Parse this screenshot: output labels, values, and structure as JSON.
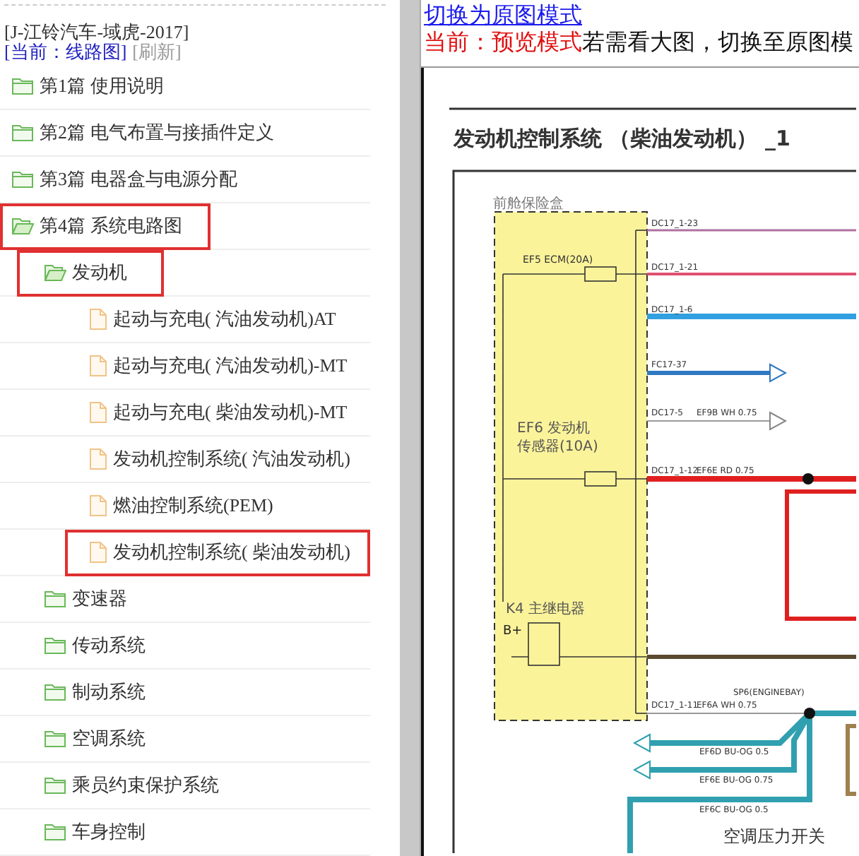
{
  "sidebar": {
    "book_title": "[J-江铃汽车-域虎-2017]",
    "current": "[当前：线路图]",
    "refresh": "[刷新]",
    "tree": [
      {
        "kind": "folder",
        "label": "第1篇 使用说明",
        "expanded": false,
        "marked": false
      },
      {
        "kind": "folder",
        "label": "第2篇 电气布置与接插件定义",
        "expanded": false,
        "marked": false
      },
      {
        "kind": "folder",
        "label": "第3篇 电器盒与电源分配",
        "expanded": false,
        "marked": false
      },
      {
        "kind": "folder",
        "label": "第4篇 系统电路图",
        "expanded": true,
        "marked": true,
        "children": [
          {
            "kind": "folder",
            "label": "发动机",
            "expanded": true,
            "marked": true,
            "children": [
              {
                "kind": "file",
                "label": "起动与充电( 汽油发动机)AT",
                "marked": false
              },
              {
                "kind": "file",
                "label": "起动与充电( 汽油发动机)-MT",
                "marked": false
              },
              {
                "kind": "file",
                "label": "起动与充电( 柴油发动机)-MT",
                "marked": false
              },
              {
                "kind": "file",
                "label": "发动机控制系统( 汽油发动机)",
                "marked": false
              },
              {
                "kind": "file",
                "label": "燃油控制系统(PEM)",
                "marked": false
              },
              {
                "kind": "file",
                "label": "发动机控制系统( 柴油发动机)",
                "marked": true
              }
            ]
          },
          {
            "kind": "folder",
            "label": "变速器",
            "expanded": false,
            "marked": false
          },
          {
            "kind": "folder",
            "label": "传动系统",
            "expanded": false,
            "marked": false
          },
          {
            "kind": "folder",
            "label": "制动系统",
            "expanded": false,
            "marked": false
          },
          {
            "kind": "folder",
            "label": "空调系统",
            "expanded": false,
            "marked": false
          },
          {
            "kind": "folder",
            "label": "乘员约束保护系统",
            "expanded": false,
            "marked": false
          },
          {
            "kind": "folder",
            "label": "车身控制",
            "expanded": false,
            "marked": false
          }
        ]
      }
    ]
  },
  "viewer": {
    "switch_link": "切换为原图模式",
    "mode_label": "当前：预览模式",
    "hint": "若需看大图，切换至原图模"
  },
  "diagram": {
    "title": "发动机控制系统 （柴油发动机） _1",
    "labels": [
      "前舱保险盒",
      "DC17_1-23",
      "EF5 ECM(20A)",
      "DC17_1-21",
      "DC17_1-6",
      "FC17-37",
      "DC17-5",
      "EF9B WH 0.75",
      "EF6 发动机",
      "传感器(10A)",
      "DC17_1-12",
      "EF6E RD 0.75",
      "K4 主继电器",
      "B+",
      "DC17_1-11",
      "EF6A WH 0.75",
      "SP6(ENGINEBAY)",
      "EF6D BU-OG 0.5",
      "EF6E BU-OG 0.75",
      "EF6C BU-OG 0.5",
      "空调压力开关"
    ]
  }
}
